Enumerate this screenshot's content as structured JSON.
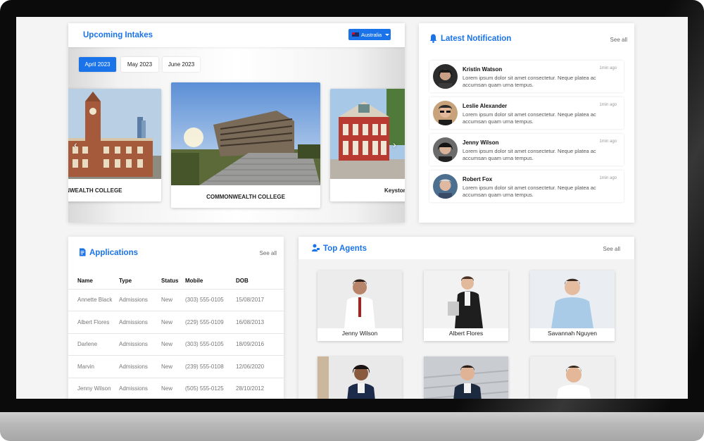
{
  "colors": {
    "accent": "#1a73e8",
    "screen_bg": "#f4f4f4"
  },
  "intakes": {
    "title": "Upcoming Intakes",
    "country": "Australia",
    "months": [
      "April 2023",
      "May 2023",
      "June 2023"
    ],
    "colleges": [
      {
        "name": "COMMONWEALTH COLLEGE",
        "visible_name": "ONWEALTH COLLEGE"
      },
      {
        "name": "COMMONWEALTH COLLEGE",
        "visible_name": "COMMONWEALTH COLLEGE"
      },
      {
        "name": "Keystone",
        "visible_name": "Keystone"
      }
    ],
    "prev_icon": "chevron-left-icon",
    "next_icon": "chevron-right-icon"
  },
  "notifications": {
    "title": "Latest Notification",
    "see_all": "See all",
    "items": [
      {
        "name": "Kristin Watson",
        "time": "1min ago",
        "text": "Lorem ipsum dolor sit amet consectetur. Neque platea ac accumsan quam urna tempus."
      },
      {
        "name": "Leslie Alexander",
        "time": "1min ago",
        "text": "Lorem ipsum dolor sit amet consectetur. Neque platea ac accumsan quam urna tempus."
      },
      {
        "name": "Jenny Wilson",
        "time": "1min ago",
        "text": "Lorem ipsum dolor sit amet consectetur. Neque platea ac accumsan quam urna tempus."
      },
      {
        "name": "Robert Fox",
        "time": "1min ago",
        "text": "Lorem ipsum dolor sit amet consectetur. Neque platea ac accumsan quam urna tempus."
      }
    ]
  },
  "applications": {
    "title": "Applications",
    "see_all": "See all",
    "columns": [
      "Name",
      "Type",
      "Status",
      "Mobile",
      "DOB"
    ],
    "rows": [
      [
        "Annette Black",
        "Admissions",
        "New",
        "(303) 555-0105",
        "15/08/2017"
      ],
      [
        "Albert Flores",
        "Admissions",
        "New",
        "(229) 555-0109",
        "16/08/2013"
      ],
      [
        "Darlene",
        "Admissions",
        "New",
        "(303) 555-0105",
        "18/09/2016"
      ],
      [
        "Marvin",
        "Admissions",
        "New",
        "(239) 555-0108",
        "12/06/2020"
      ],
      [
        "Jenny Wilson",
        "Admissions",
        "New",
        "(505) 555-0125",
        "28/10/2012"
      ]
    ]
  },
  "agents": {
    "title": "Top Agents",
    "see_all": "See all",
    "items": [
      {
        "name": "Jenny Wilson"
      },
      {
        "name": "Albert Flores"
      },
      {
        "name": "Savannah Nguyen"
      },
      {
        "name": ""
      },
      {
        "name": ""
      },
      {
        "name": ""
      }
    ]
  }
}
